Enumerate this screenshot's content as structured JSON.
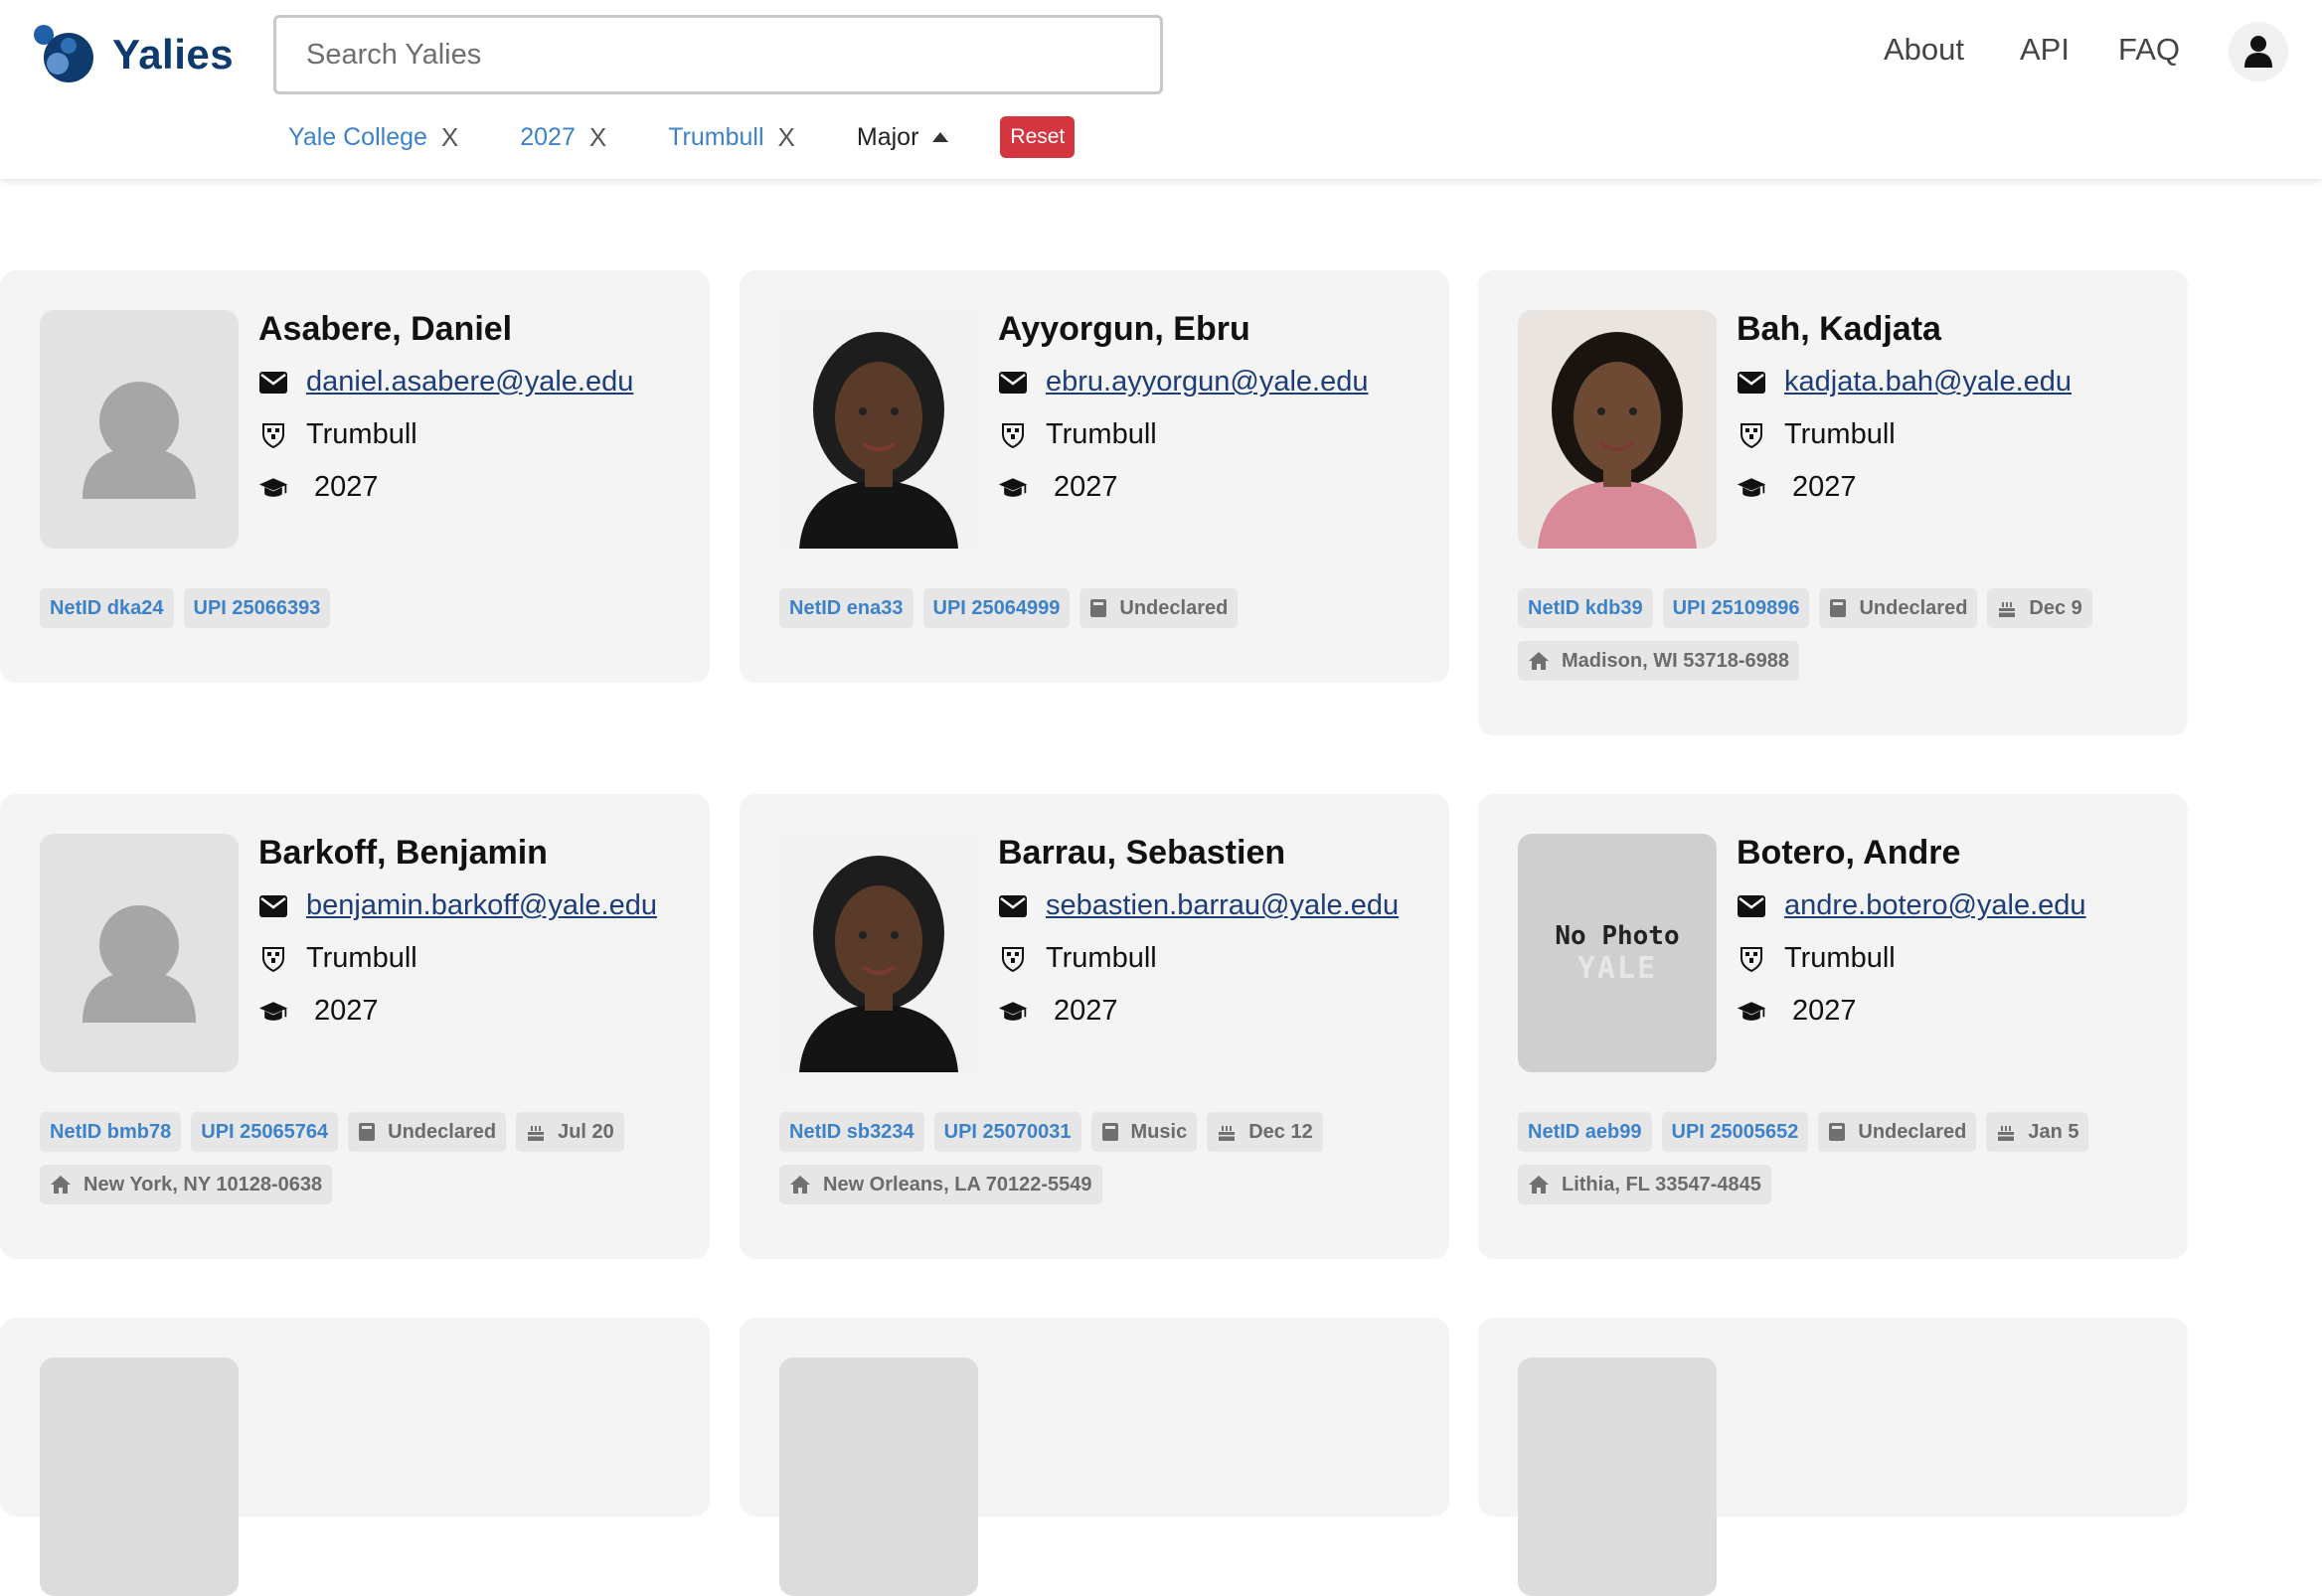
{
  "app": {
    "name": "Yalies"
  },
  "search": {
    "placeholder": "Search Yalies"
  },
  "nav": {
    "about": "About",
    "api": "API",
    "faq": "FAQ"
  },
  "filters": {
    "chips": [
      "Yale College",
      "2027",
      "Trumbull"
    ],
    "remove_label": "X",
    "major_label": "Major",
    "reset_label": "Reset"
  },
  "colors": {
    "brand": "#0f3a6e",
    "link": "#1d3d78",
    "tag_blue": "#3d82c9",
    "reset": "#d3363f"
  },
  "students": [
    {
      "name": "Asabere, Daniel",
      "email": "daniel.asabere@yale.edu",
      "college": "Trumbull",
      "year": "2027",
      "photo": "placeholder-silhouette",
      "netid": "NetID dka24",
      "upi": "UPI 25066393",
      "major": null,
      "birthday": null,
      "address": null
    },
    {
      "name": "Ayyorgun, Ebru",
      "email": "ebru.ayyorgun@yale.edu",
      "college": "Trumbull",
      "year": "2027",
      "photo": "portrait",
      "netid": "NetID ena33",
      "upi": "UPI 25064999",
      "major": "Undeclared",
      "birthday": null,
      "address": null
    },
    {
      "name": "Bah, Kadjata",
      "email": "kadjata.bah@yale.edu",
      "college": "Trumbull",
      "year": "2027",
      "photo": "portrait",
      "netid": "NetID kdb39",
      "upi": "UPI 25109896",
      "major": "Undeclared",
      "birthday": "Dec 9",
      "address": "Madison, WI 53718-6988"
    },
    {
      "name": "Barkoff, Benjamin",
      "email": "benjamin.barkoff@yale.edu",
      "college": "Trumbull",
      "year": "2027",
      "photo": "placeholder-silhouette",
      "netid": "NetID bmb78",
      "upi": "UPI 25065764",
      "major": "Undeclared",
      "birthday": "Jul 20",
      "address": "New York, NY 10128-0638"
    },
    {
      "name": "Barrau, Sebastien",
      "email": "sebastien.barrau@yale.edu",
      "college": "Trumbull",
      "year": "2027",
      "photo": "portrait",
      "netid": "NetID sb3234",
      "upi": "UPI 25070031",
      "major": "Music",
      "birthday": "Dec 12",
      "address": "New Orleans, LA 70122-5549"
    },
    {
      "name": "Botero, Andre",
      "email": "andre.botero@yale.edu",
      "college": "Trumbull",
      "year": "2027",
      "photo": "no-photo",
      "no_photo_text": "No Photo",
      "no_photo_sub": "YALE",
      "netid": "NetID aeb99",
      "upi": "UPI 25005652",
      "major": "Undeclared",
      "birthday": "Jan 5",
      "address": "Lithia, FL 33547-4845"
    }
  ]
}
